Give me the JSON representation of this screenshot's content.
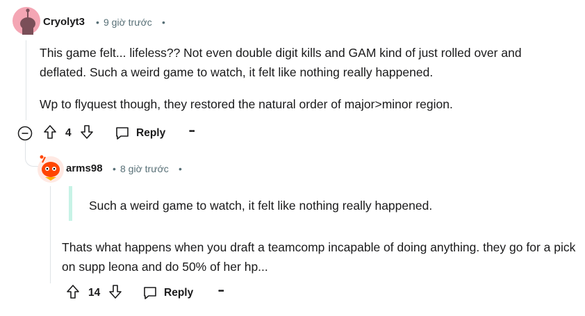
{
  "comments": [
    {
      "username": "Cryolyt3",
      "separator": "•",
      "time": "9 giờ trước",
      "separator_after": "•",
      "paragraphs": [
        "This game felt... lifeless?? Not even double digit kills and GAM kind of just rolled over and deflated. Such a weird game to watch, it felt like nothing really happened.",
        "Wp to flyquest though, they restored the natural order of major>minor region."
      ],
      "votes": "4",
      "reply_label": "Reply",
      "more_label": "•••"
    },
    {
      "username": "arms98",
      "separator": "•",
      "time": "8 giờ trước",
      "separator_after": "•",
      "quote": "Such a weird game to watch, it felt like nothing really happened.",
      "paragraphs": [
        "Thats what happens when you draft a teamcomp incapable of doing anything. they go for a pick on supp leona and do 50% of her hp..."
      ],
      "votes": "14",
      "reply_label": "Reply",
      "more_label": "•••"
    }
  ],
  "icons": {
    "upvote": "arrow-up-icon",
    "downvote": "arrow-down-icon",
    "reply": "speech-bubble-icon",
    "collapse": "collapse-minus-icon"
  },
  "colors": {
    "quote_bar": "#c7f3e6",
    "avatar1_bg": "#f4a6b4",
    "avatar2_bg": "#ff4500"
  }
}
